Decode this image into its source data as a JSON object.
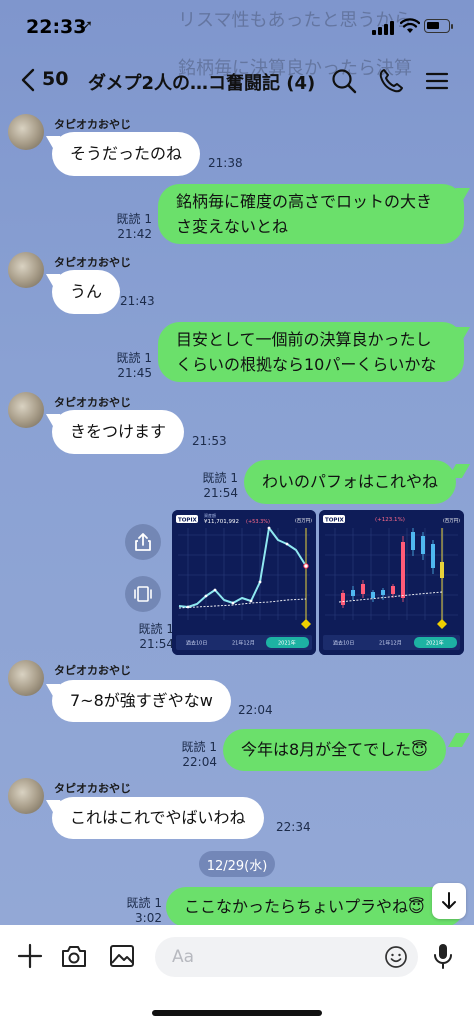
{
  "status": {
    "time": "22:33",
    "location_arrow": "➚"
  },
  "ghost": {
    "line1": "リスマ性もあったと思うから",
    "line2": "銘柄毎に決算良かったら決算"
  },
  "header": {
    "back_count": "50",
    "title": "ダメプ2人の…コ奮闘記 (4)",
    "icons": [
      "search-icon",
      "phone-icon",
      "menu-icon"
    ]
  },
  "messages": [
    {
      "side": "left",
      "sender": "タピオカおやじ",
      "text": "そうだったのね",
      "time": "21:38"
    },
    {
      "side": "right",
      "text_lines": [
        "銘柄毎に確度の高さでロットの大き",
        "さ変えないとね"
      ],
      "read": "既読 1",
      "time": "21:42"
    },
    {
      "side": "left",
      "sender": "タピオカおやじ",
      "text": "うん",
      "time": "21:43"
    },
    {
      "side": "right",
      "text_lines": [
        "目安として一個前の決算良かったし",
        "くらいの根拠なら10パーくらいかな"
      ],
      "read": "既読 1",
      "time": "21:45"
    },
    {
      "side": "left",
      "sender": "タピオカおやじ",
      "text": "きをつけます",
      "time": "21:53"
    },
    {
      "side": "right",
      "text": "わいのパフォはこれやね",
      "read": "既読 1",
      "time": "21:54"
    },
    {
      "side": "right",
      "type": "images",
      "read": "既読 1",
      "time": "21:54",
      "image1": {
        "badge": "TOPIX",
        "value_label": "資産額",
        "value": "¥11,701,992",
        "change": "(+53.3%)",
        "unit": "(百万円)",
        "tabs": [
          "過去10日",
          "21年12月",
          "2021年"
        ]
      },
      "image2": {
        "badge": "TOPIX",
        "change": "(+123.1%)",
        "unit": "(百万円)",
        "tabs": [
          "過去10日",
          "21年12月",
          "2021年"
        ]
      }
    },
    {
      "side": "left",
      "sender": "タピオカおやじ",
      "text": "7~8が強すぎやなw",
      "time": "22:04"
    },
    {
      "side": "right",
      "text": "今年は8月が全てでした😇",
      "read": "既読 1",
      "time": "22:04"
    },
    {
      "side": "left",
      "sender": "タピオカおやじ",
      "text": "これはこれでやばいわね",
      "time": "22:34"
    },
    {
      "side": "right",
      "text": "ここなかったらちょいプラやね😇",
      "read": "既読 1",
      "time": "3:02"
    }
  ],
  "date_divider": "12/29(水)",
  "composer": {
    "placeholder": "Aa"
  }
}
